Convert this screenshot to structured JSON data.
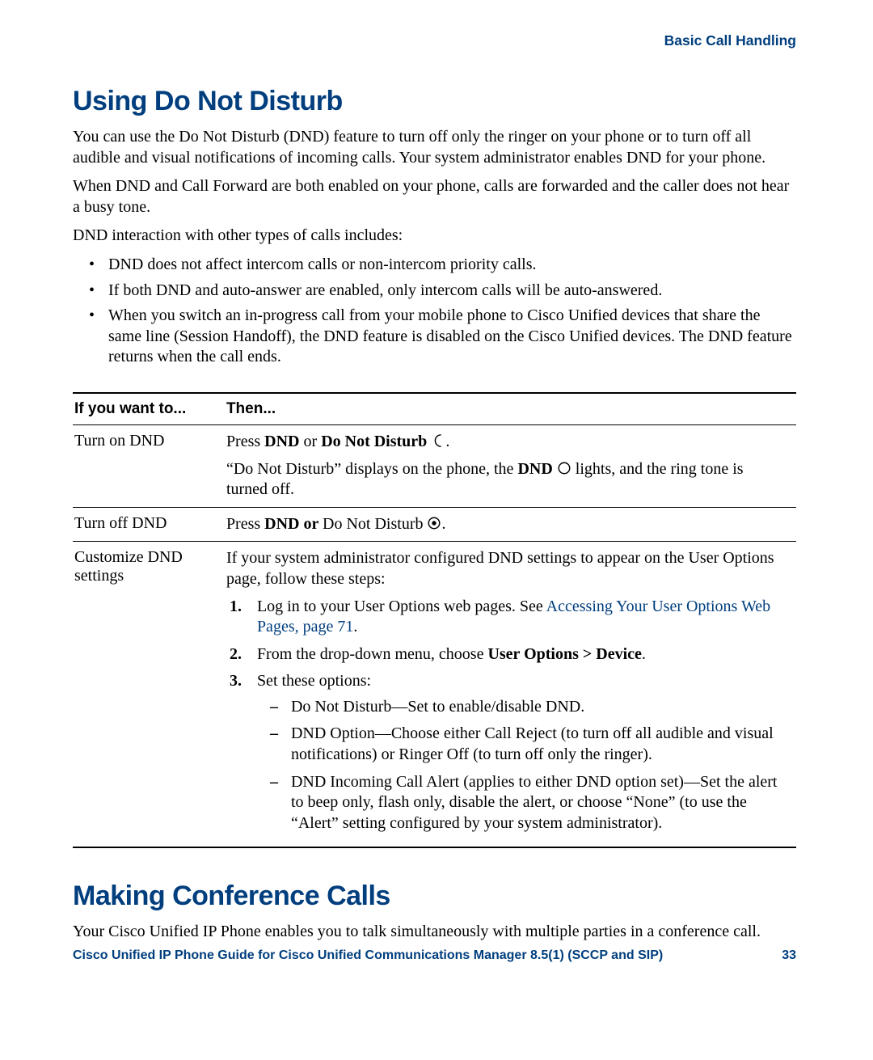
{
  "header": {
    "breadcrumb": "Basic Call Handling"
  },
  "section1": {
    "title": "Using Do Not Disturb",
    "p1": "You can use the Do Not Disturb (DND) feature to turn off only the ringer on your phone or to turn off all audible and visual notifications of incoming calls. Your system administrator enables DND for your phone.",
    "p2": "When DND and Call Forward are both enabled on your phone, calls are forwarded and the caller does not hear a busy tone.",
    "p3": "DND interaction with other types of calls includes:",
    "bullets": [
      "DND does not affect intercom calls or non-intercom priority calls.",
      "If both DND and auto-answer are enabled, only intercom calls will be auto-answered.",
      "When you switch an in-progress call from your mobile phone to Cisco Unified devices that share the same line (Session Handoff), the DND feature is disabled on the Cisco Unified devices. The DND feature returns when the call ends."
    ]
  },
  "table": {
    "headers": [
      "If you want to...",
      "Then..."
    ],
    "row1": {
      "c1": "Turn on DND",
      "line1a": "Press ",
      "line1b_bold": "DND",
      "line1c": " or ",
      "line1d_bold": "Do Not Disturb ",
      "line1e": ".",
      "line2a": "“Do Not Disturb” displays on the phone, the ",
      "line2b_bold": "DND ",
      "line2c": " lights, and the ring tone is turned off."
    },
    "row2": {
      "c1": "Turn off DND",
      "line1a": "Press ",
      "line1b_bold": "DND or ",
      "line1c": "Do Not Disturb ",
      "line1d": "."
    },
    "row3": {
      "c1": "Customize DND settings",
      "intro": "If your system administrator configured DND settings to appear on the User Options page, follow these steps:",
      "step1a": "Log in to your User Options web pages. See ",
      "step1_link": "Accessing Your User Options Web Pages, page 71",
      "step1b": ".",
      "step2a": "From the drop-down menu, choose ",
      "step2b_bold": "User Options > Device",
      "step2c": ".",
      "step3": "Set these options:",
      "dash1": "Do Not Disturb—Set to enable/disable DND.",
      "dash2": "DND Option—Choose either Call Reject (to turn off all audible and visual notifications) or Ringer Off (to turn off only the ringer).",
      "dash3": "DND Incoming Call Alert (applies to either DND option set)—Set the alert to beep only, flash only, disable the alert, or choose “None” (to use the “Alert” setting configured by your system administrator)."
    }
  },
  "section2": {
    "title": "Making Conference Calls",
    "p1": "Your Cisco Unified IP Phone enables you to talk simultaneously with multiple parties in a conference call."
  },
  "footer": {
    "guide": "Cisco Unified IP Phone Guide for Cisco Unified Communications Manager 8.5(1) (SCCP and SIP)",
    "page": "33"
  }
}
